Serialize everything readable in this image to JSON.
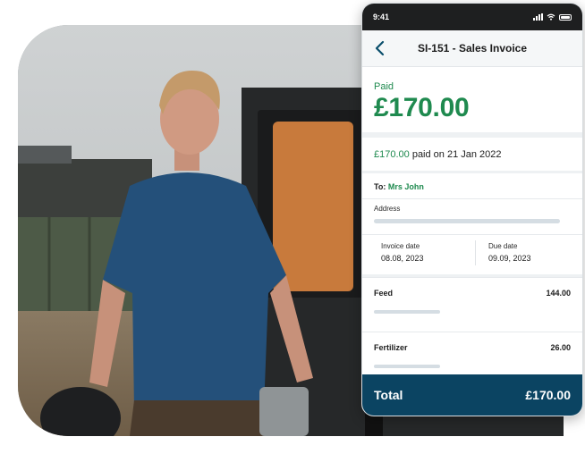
{
  "status": {
    "time": "9:41"
  },
  "nav": {
    "title": "SI-151 - Sales Invoice"
  },
  "payment": {
    "label": "Paid",
    "amount": "£170.00"
  },
  "paid_line": {
    "amount": "£170.00",
    "text": " paid on 21 Jan 2022"
  },
  "recipient": {
    "prefix": "To: ",
    "name": "Mrs John"
  },
  "address": {
    "label": "Address"
  },
  "dates": {
    "invoice_label": "Invoice date",
    "invoice_value": "08.08, 2023",
    "due_label": "Due date",
    "due_value": "09.09, 2023"
  },
  "items": [
    {
      "name": "Feed",
      "amount": "144.00"
    },
    {
      "name": "Fertilizer",
      "amount": "26.00"
    }
  ],
  "total": {
    "label": "Total",
    "amount": "£170.00"
  },
  "colors": {
    "accent_green": "#1f8a4f",
    "brand_blue": "#0b4462"
  }
}
